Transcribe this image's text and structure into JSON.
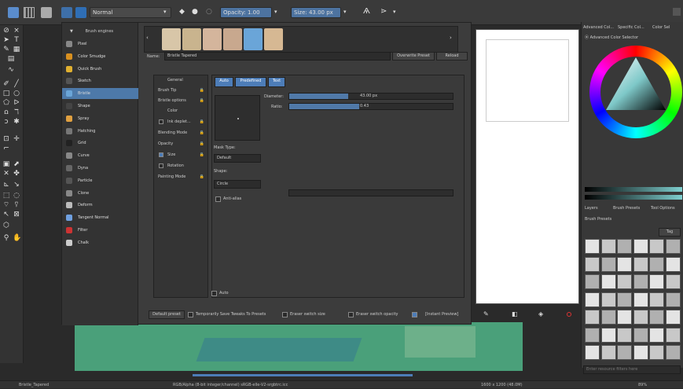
{
  "topbar": {
    "blend_mode": "Normal",
    "opacity_label": "Opacity: 1.00",
    "size_label": "Size: 43.00 px"
  },
  "dialog": {
    "engines_header": "Brush engines",
    "engines": [
      "Pixel",
      "Color Smudge",
      "Quick Brush",
      "Sketch",
      "Bristle",
      "Shape",
      "Spray",
      "Hatching",
      "Grid",
      "Curve",
      "Dyna",
      "Particle",
      "Clone",
      "Deform",
      "Tangent Normal",
      "Filter",
      "Chalk"
    ],
    "name_label": "Name:",
    "name_value": "Bristle Tapered",
    "overwrite": "Overwrite Preset",
    "reload": "Reload",
    "options": [
      "General",
      "Brush Tip",
      "Bristle options",
      "Color",
      "Ink deplet...",
      "Blending Mode",
      "Opacity",
      "Size",
      "Rotation",
      "Painting Mode"
    ],
    "tabs": [
      "Auto",
      "Predefined",
      "Text"
    ],
    "diameter_label": "Diameter:",
    "diameter_value": "43.00 px",
    "ratio_label": "Ratio:",
    "ratio_value": "0.43",
    "mask_type_label": "Mask Type:",
    "mask_type": "Default",
    "shape_label": "Shape:",
    "shape": "Circle",
    "antialias": "Anti-alias",
    "auto_label": "Auto",
    "default_preset": "Default preset",
    "temp_save": "Temporarily Save Tweaks To Presets",
    "eraser_size": "Eraser switch size",
    "eraser_opacity": "Eraser switch opacity",
    "instant_preview": "[Instant Preview]"
  },
  "right": {
    "tabs": [
      "Advanced Col...",
      "Specific Col...",
      "Color Sel"
    ],
    "selector_title": "Advanced Color Selector",
    "dock_tabs": [
      "Layers",
      "Brush Presets",
      "Tool Options"
    ],
    "presets_title": "Brush Presets",
    "tag": "Tag",
    "filter_placeholder": "Enter resource filters here"
  },
  "status": {
    "brush": "Bristle_Tapered",
    "color": "RGB/Alpha (8-bit integer/channel)  sRGB-elle-V2-srgbtrc.icc",
    "dims": "1600 x 1200 (48.0M)",
    "zoom": "89%"
  }
}
